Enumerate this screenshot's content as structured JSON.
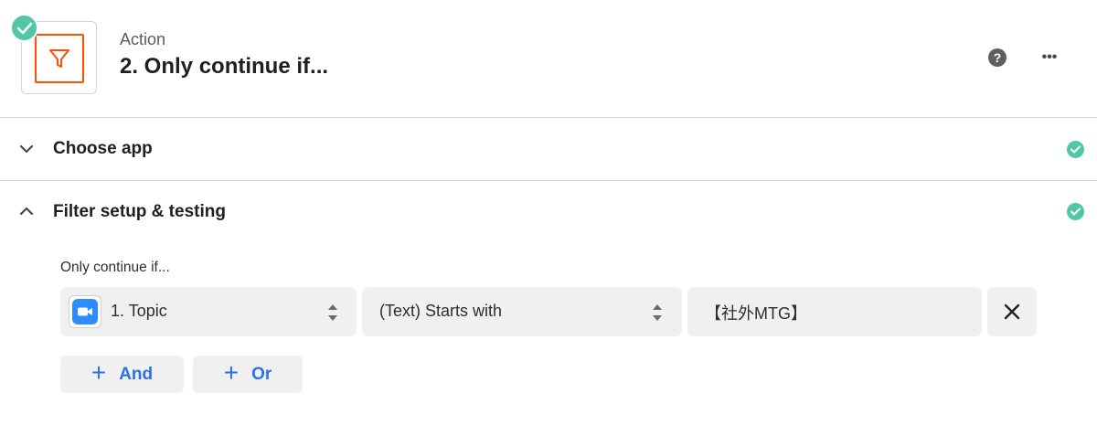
{
  "header": {
    "step_kind": "Action",
    "step_title": "2. Only continue if...",
    "help_label": "?",
    "more_label": "•••",
    "app_icon": "filter-icon",
    "accent_color": "#ff4f00",
    "status_color": "#50c8a8"
  },
  "sections": {
    "choose_app": {
      "title": "Choose app",
      "state": "collapsed"
    },
    "filter_setup": {
      "title": "Filter setup & testing",
      "state": "expanded"
    }
  },
  "filter": {
    "label": "Only continue if...",
    "field": {
      "icon": "zoom-icon",
      "value": "1. Topic"
    },
    "condition": {
      "value": "(Text) Starts with"
    },
    "value": "【社外MTG】",
    "and_label": "And",
    "or_label": "Or",
    "button_color": "#2f6fe6"
  }
}
